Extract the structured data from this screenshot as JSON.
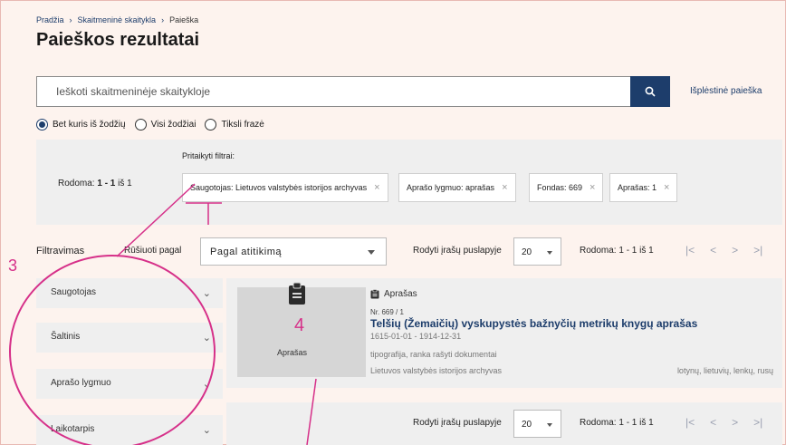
{
  "breadcrumb": {
    "items": [
      "Pradžia",
      "Skaitmeninė skaitykla",
      "Paieška"
    ],
    "separator": "›"
  },
  "page_title": "Paieškos rezultatai",
  "search": {
    "placeholder": "Ieškoti skaitmeninėje skaitykloje",
    "value": "",
    "icon": "search-icon",
    "advanced_label": "Išplėstinė paieška"
  },
  "match_mode": {
    "options": [
      "Bet kuris iš žodžių",
      "Visi žodžiai",
      "Tiksli frazė"
    ],
    "selected": "Bet kuris iš žodžių"
  },
  "filters_bar": {
    "showing_prefix": "Rodoma:",
    "showing_range": "1 - 1",
    "showing_suffix": "iš 1",
    "applied_label": "Pritaikyti filtrai:",
    "chips": [
      "Saugotojas: Lietuvos valstybės istorijos archyvas",
      "Aprašo lygmuo: aprašas",
      "Fondas: 669",
      "Aprašas: 1"
    ],
    "remove_symbol": "×"
  },
  "toolbar": {
    "filtering_title": "Filtravimas",
    "sort_label": "Rūšiuoti pagal",
    "sort_value": "Pagal atitikimą",
    "per_page_label": "Rodyti įrašų puslapyje",
    "per_page_value": "20",
    "count_text": "Rodoma: 1 - 1 iš 1",
    "pager": [
      "|<",
      "<",
      ">",
      ">|"
    ]
  },
  "facets": [
    "Saugotojas",
    "Šaltinis",
    "Aprašo lygmuo",
    "Laikotarpis"
  ],
  "facet_chevron": "⌄",
  "result": {
    "thumb_label": "Aprašas",
    "type_label": "Aprašas",
    "nr": "Nr. 669 / 1",
    "title": "Telšių (Žemaičių) vyskupystės bažnyčių metrikų knygų aprašas",
    "dates": "1615-01-01 - 1914-12-31",
    "tags": "tipografija, ranka rašyti dokumentai",
    "holder": "Lietuvos valstybės istorijos archyvas",
    "languages": "lotynų, lietuvių, lenkų, rusų"
  },
  "annotations": {
    "label_3": "3",
    "label_4": "4",
    "color": "#d63089"
  },
  "colors": {
    "primary": "#1d3d6b",
    "panel": "#efefef",
    "background": "#fdf3ee"
  }
}
